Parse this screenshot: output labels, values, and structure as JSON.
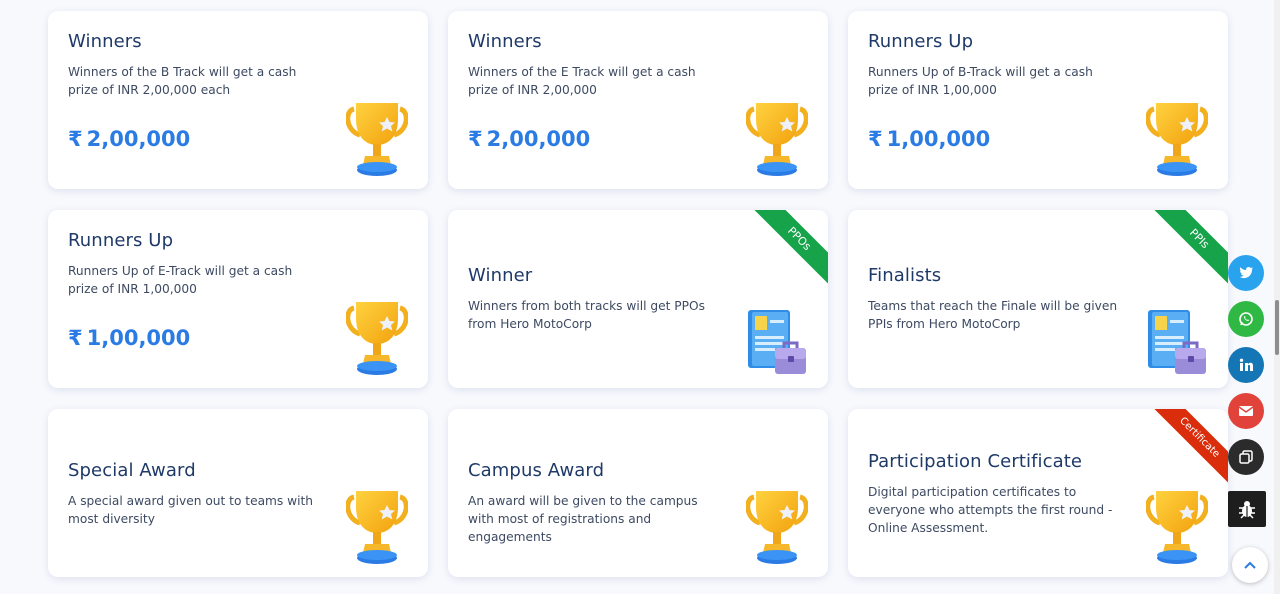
{
  "cards": [
    {
      "title": "Winners",
      "desc": "Winners of the B Track will get a cash prize of INR 2,00,000 each",
      "amount": "2,00,000",
      "currency": "₹",
      "icon": "trophy-icon"
    },
    {
      "title": "Winners",
      "desc": "Winners of the E Track will get a cash prize of INR 2,00,000",
      "amount": "2,00,000",
      "currency": "₹",
      "icon": "trophy-icon"
    },
    {
      "title": "Runners Up",
      "desc": "Runners Up of B-Track will get a cash prize of INR 1,00,000",
      "amount": "1,00,000",
      "currency": "₹",
      "icon": "trophy-icon"
    },
    {
      "title": "Runners Up",
      "desc": "Runners Up of E-Track will get a cash prize of INR 1,00,000",
      "amount": "1,00,000",
      "currency": "₹",
      "icon": "trophy-icon"
    },
    {
      "title": "Winner",
      "desc": "Winners from both tracks will get PPOs from Hero MotoCorp",
      "ribbon": "PPOs",
      "ribbon_color": "#16a34a",
      "icon": "document-briefcase-icon"
    },
    {
      "title": "Finalists",
      "desc": "Teams that reach the Finale will be given PPIs from Hero MotoCorp",
      "ribbon": "PPIs",
      "ribbon_color": "#16a34a",
      "icon": "document-briefcase-icon"
    },
    {
      "title": "Special Award",
      "desc": "A special award given out to teams with most diversity",
      "icon": "trophy-icon"
    },
    {
      "title": "Campus Award",
      "desc": "An award will be given to the campus with most of registrations and engagements",
      "icon": "trophy-icon"
    },
    {
      "title": "Participation Certificate",
      "desc": "Digital participation certificates to everyone who attempts the first round - Online Assessment.",
      "ribbon": "Certificate",
      "ribbon_color": "#d92d0c",
      "icon": "trophy-icon"
    }
  ],
  "share": [
    {
      "name": "twitter",
      "color": "#2aa3ef"
    },
    {
      "name": "whatsapp",
      "color": "#2fb944"
    },
    {
      "name": "linkedin",
      "color": "#1476b5"
    },
    {
      "name": "email",
      "color": "#e1423a"
    },
    {
      "name": "copy",
      "color": "#2b2b2b"
    }
  ]
}
